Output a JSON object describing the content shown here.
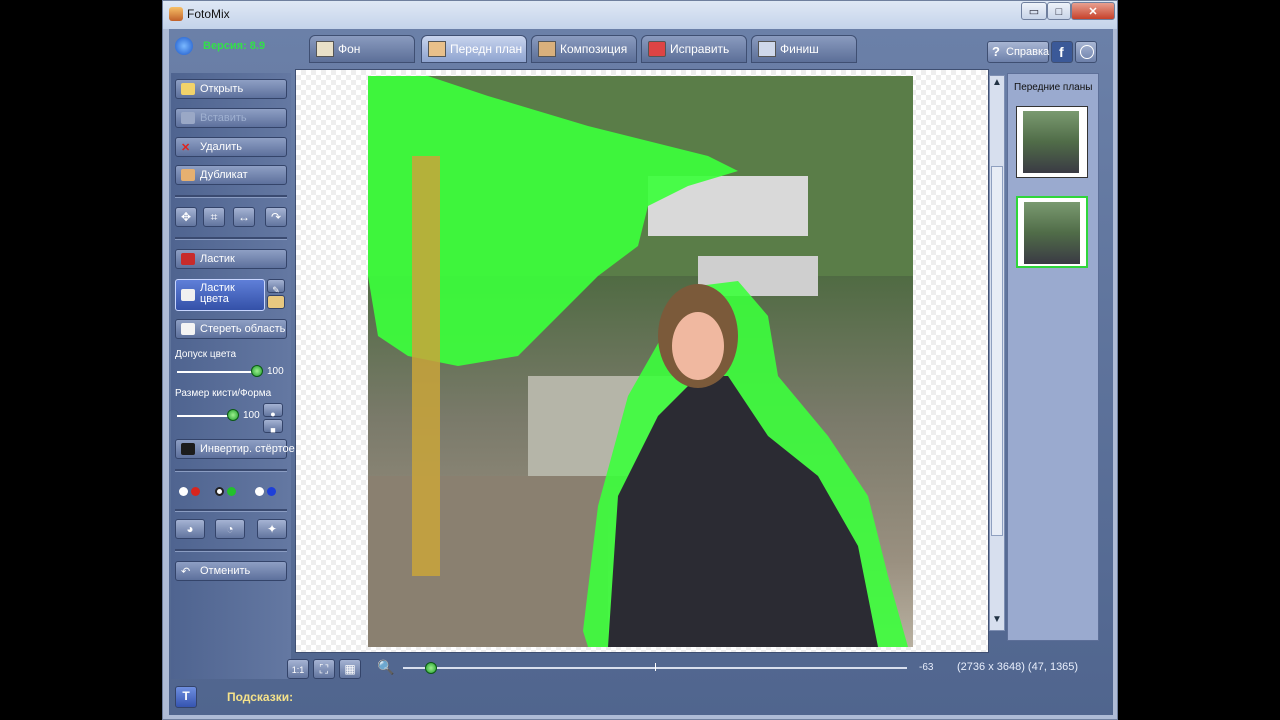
{
  "window": {
    "title": "FotoMix",
    "controls": {
      "minimize": "▭",
      "maximize": "□",
      "close": "✕"
    }
  },
  "app": {
    "version_label": "Версия: 8.9"
  },
  "tabs": [
    {
      "label": "Фон",
      "active": false
    },
    {
      "label": "Передн план",
      "active": true
    },
    {
      "label": "Композиция",
      "active": false
    },
    {
      "label": "Исправить",
      "active": false
    },
    {
      "label": "Финиш",
      "active": false
    }
  ],
  "top_right": {
    "help_label": "Справка",
    "help_icon": "question-icon",
    "facebook_icon": "facebook-icon",
    "web_icon": "globe-icon"
  },
  "left_panel": {
    "open": "Открыть",
    "paste": "Вставить",
    "delete": "Удалить",
    "duplicate": "Дубликат",
    "eraser": "Ластик",
    "color_eraser": "Ластик цвета",
    "erase_area": "Стереть область",
    "tolerance_label": "Допуск цвета",
    "tolerance_value": "100",
    "brush_label": "Размер кисти/Форма",
    "brush_value": "100",
    "invert": "Инвертир. стёртое",
    "undo": "Отменить",
    "color_pairs": [
      "#d8251e",
      "#22c12b",
      "#1e3fd8"
    ]
  },
  "right_panel": {
    "title": "Передние планы",
    "thumb_count": 2
  },
  "bottom": {
    "zoom_value": "-63",
    "image_info": "(2736 x 3648) (47, 1365)",
    "btn_1to1": "1:1"
  },
  "hints": {
    "label": "Подсказки:",
    "icon": "T"
  },
  "colors": {
    "accent_green": "#33e04a",
    "app_blue": "#5d709c",
    "mask_green": "#3cff3c"
  }
}
